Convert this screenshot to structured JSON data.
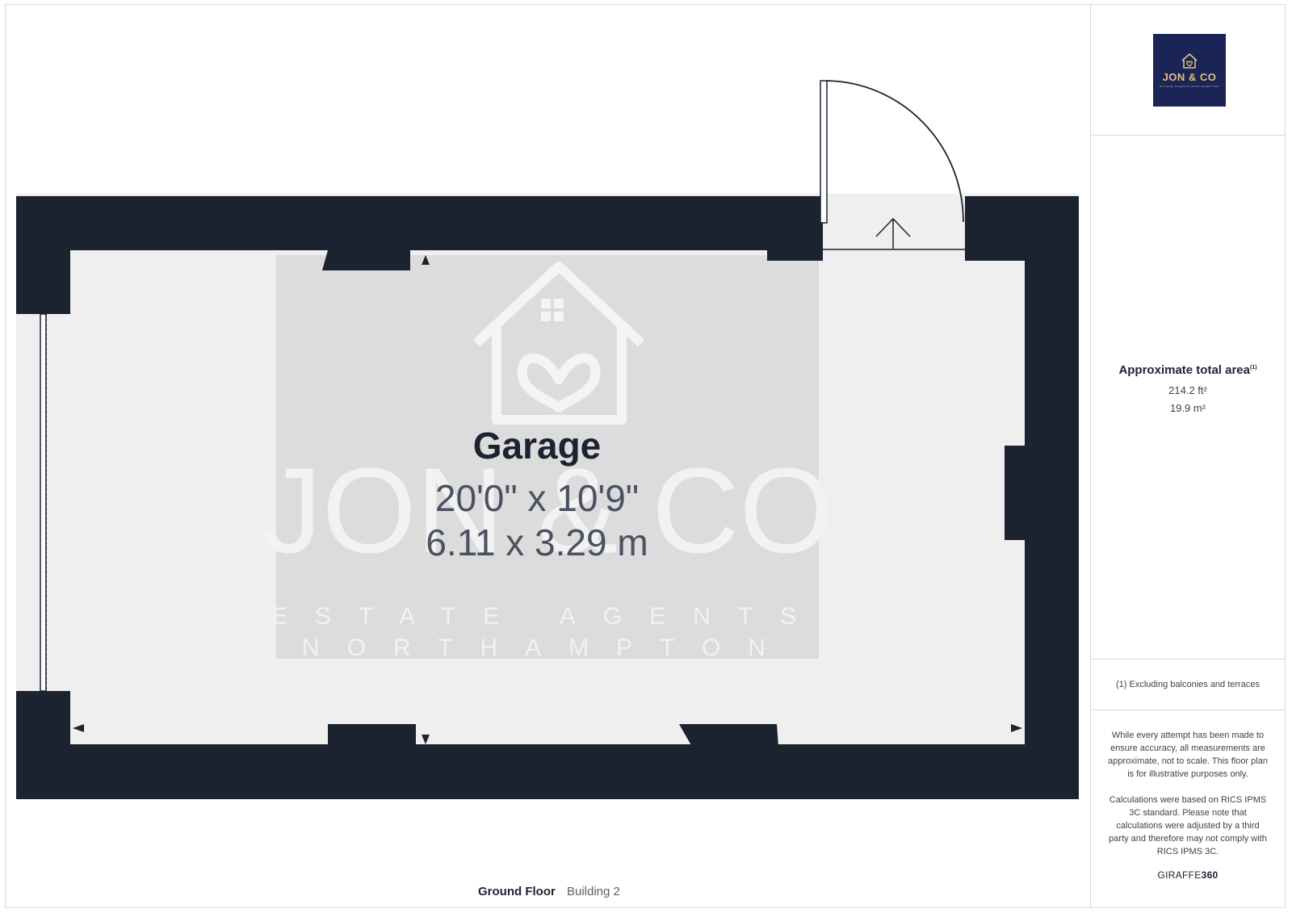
{
  "room": {
    "name": "Garage",
    "dim_imperial": "20'0\" x 10'9\"",
    "dim_metric": "6.11 x 3.29 m"
  },
  "floor": {
    "name": "Ground Floor",
    "building": "Building 2"
  },
  "watermark": {
    "brand": "JON & CO",
    "line1": "ESTATE AGENTS",
    "line2": "NORTHAMPTON"
  },
  "logo": {
    "text": "JON & CO",
    "subtext": "ESTATE AGENTS NORTHAMPTON",
    "background": "#1a2456",
    "accent": "#e3c27c"
  },
  "area": {
    "title": "Approximate total area",
    "footnote_marker": "(1)",
    "sqft": "214.2 ft²",
    "sqm": "19.9 m²"
  },
  "notes": {
    "exclusion": "(1) Excluding balconies and terraces",
    "disclaimer_1": "While every attempt has been made to ensure accuracy, all measurements are approximate, not to scale. This floor plan is for illustrative purposes only.",
    "disclaimer_2": "Calculations were based on RICS IPMS 3C standard. Please note that calculations were adjusted by a third party and therefore may not comply with RICS IPMS 3C."
  },
  "brand": {
    "prefix": "GIRAFFE",
    "suffix": "360"
  },
  "colors": {
    "wall": "#1b2330",
    "floor": "#efefef",
    "watermark_bg": "#dcdcdc"
  }
}
